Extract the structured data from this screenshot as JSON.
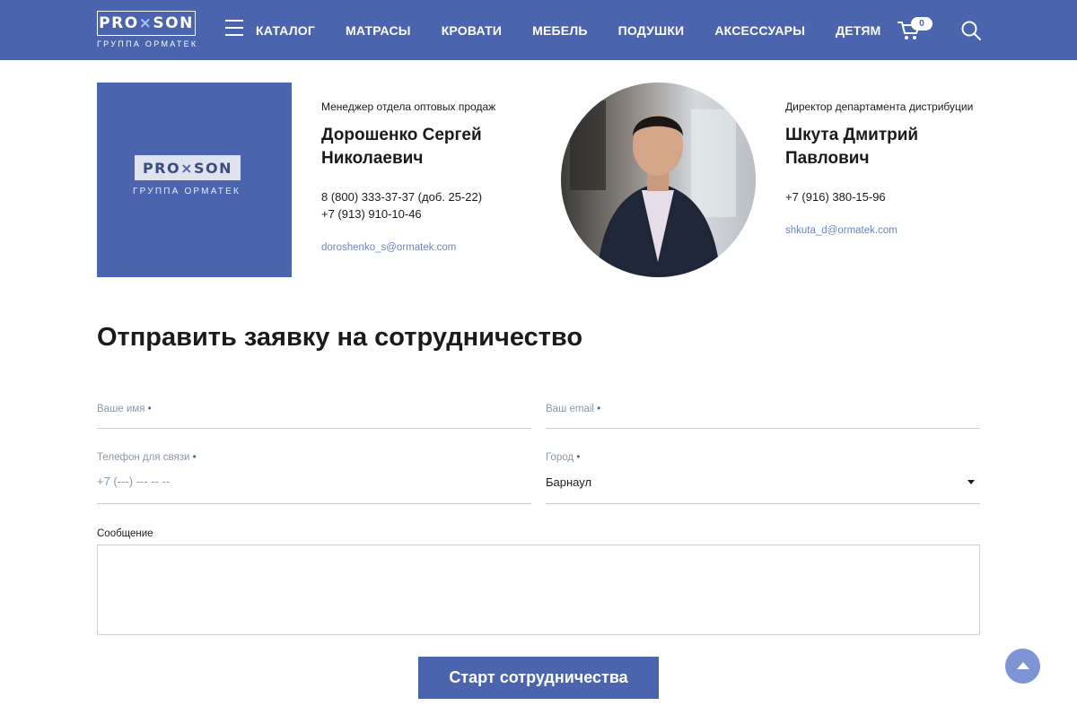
{
  "header": {
    "logo_text_left": "PRO",
    "logo_text_x": "×",
    "logo_text_right": "SON",
    "logo_sub": "ГРУППА ОРМАТЕК",
    "nav": [
      "КАТАЛОГ",
      "МАТРАСЫ",
      "КРОВАТИ",
      "МЕБЕЛЬ",
      "ПОДУШКИ",
      "АКСЕССУАРЫ",
      "ДЕТЯМ"
    ],
    "cart_count": "0",
    "icons": {
      "menu": "burger-menu-icon",
      "cart": "cart-icon",
      "search": "search-icon"
    }
  },
  "contacts": [
    {
      "role": "Менеджер отдела оптовых продаж",
      "name": "Дорошенко Сергей Николаевич",
      "phones": [
        "8 (800) 333-37-37 (доб. 25-22)",
        "+7 (913) 910-10-46"
      ],
      "email": "doroshenko_s@ormatek.com",
      "image": "company-logo",
      "logo_text_left": "PRO",
      "logo_text_x": "×",
      "logo_text_right": "SON",
      "logo_sub": "ГРУППА ОРМАТЕК"
    },
    {
      "role": "Директор департамента дистрибуции",
      "name": "Шкута Дмитрий Павлович",
      "phones": [
        "+7 (916) 380-15-96"
      ],
      "email": "shkuta_d@ormatek.com",
      "image": "portrait-photo"
    }
  ],
  "form": {
    "title": "Отправить заявку на сотрудничество",
    "name_label": "Ваше имя",
    "email_label": "Ваш email",
    "phone_label": "Телефон для связи",
    "phone_placeholder": "+7 (---) --- -- --",
    "city_label": "Город",
    "city_value": "Барнаул",
    "required_mark": "•",
    "message_label": "Сообщение",
    "submit_label": "Старт сотрудничества"
  },
  "colors": {
    "brand": "#4a64ae",
    "link": "#6b84c4",
    "scroll_top": "#7d95d4"
  }
}
